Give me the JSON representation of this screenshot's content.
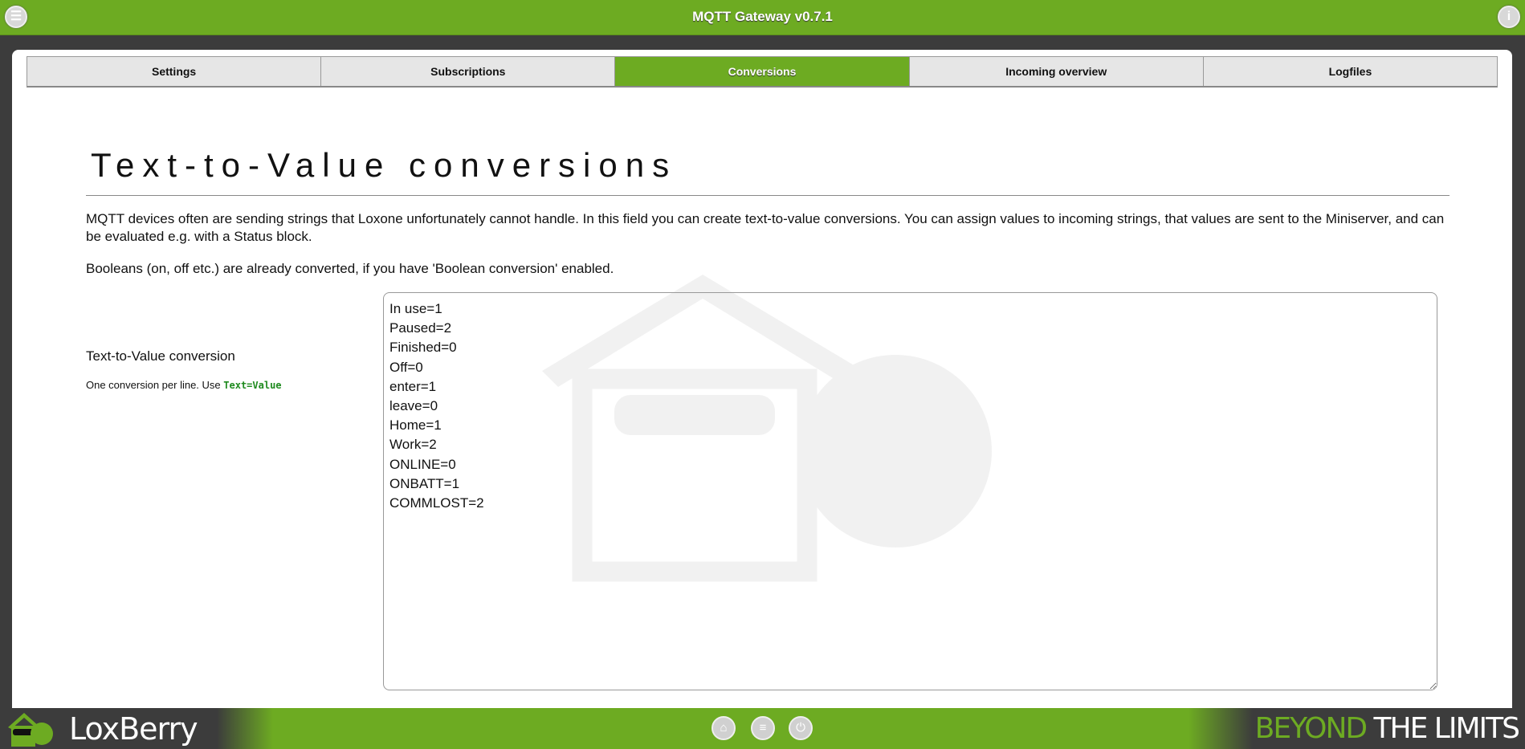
{
  "header": {
    "title": "MQTT Gateway v0.7.1"
  },
  "tabs": [
    {
      "label": "Settings"
    },
    {
      "label": "Subscriptions"
    },
    {
      "label": "Conversions"
    },
    {
      "label": "Incoming overview"
    },
    {
      "label": "Logfiles"
    }
  ],
  "main": {
    "title": "Text-to-Value conversions",
    "intro": "MQTT devices often are sending strings that Loxone unfortunately cannot handle. In this field you can create text-to-value conversions. You can assign values to incoming strings, that values are sent to the Miniserver, and can be evaluated e.g. with a Status block.",
    "booleans_note": "Booleans (on, off etc.) are already converted, if you have 'Boolean conversion' enabled.",
    "field_label": "Text-to-Value conversion",
    "hint_text": "One conversion per line. Use ",
    "hint_code": "Text=Value",
    "conversions": "In use=1\nPaused=2\nFinished=0\nOff=0\nenter=1\nleave=0\nHome=1\nWork=2\nONLINE=0\nONBATT=1\nCOMMLOST=2"
  },
  "footer": {
    "brand": "LoxBerry",
    "slogan_1": "BEYOND",
    "slogan_2": " THE LIMITS"
  },
  "colors": {
    "accent": "#6dab22",
    "dark": "#3c3c3c"
  }
}
